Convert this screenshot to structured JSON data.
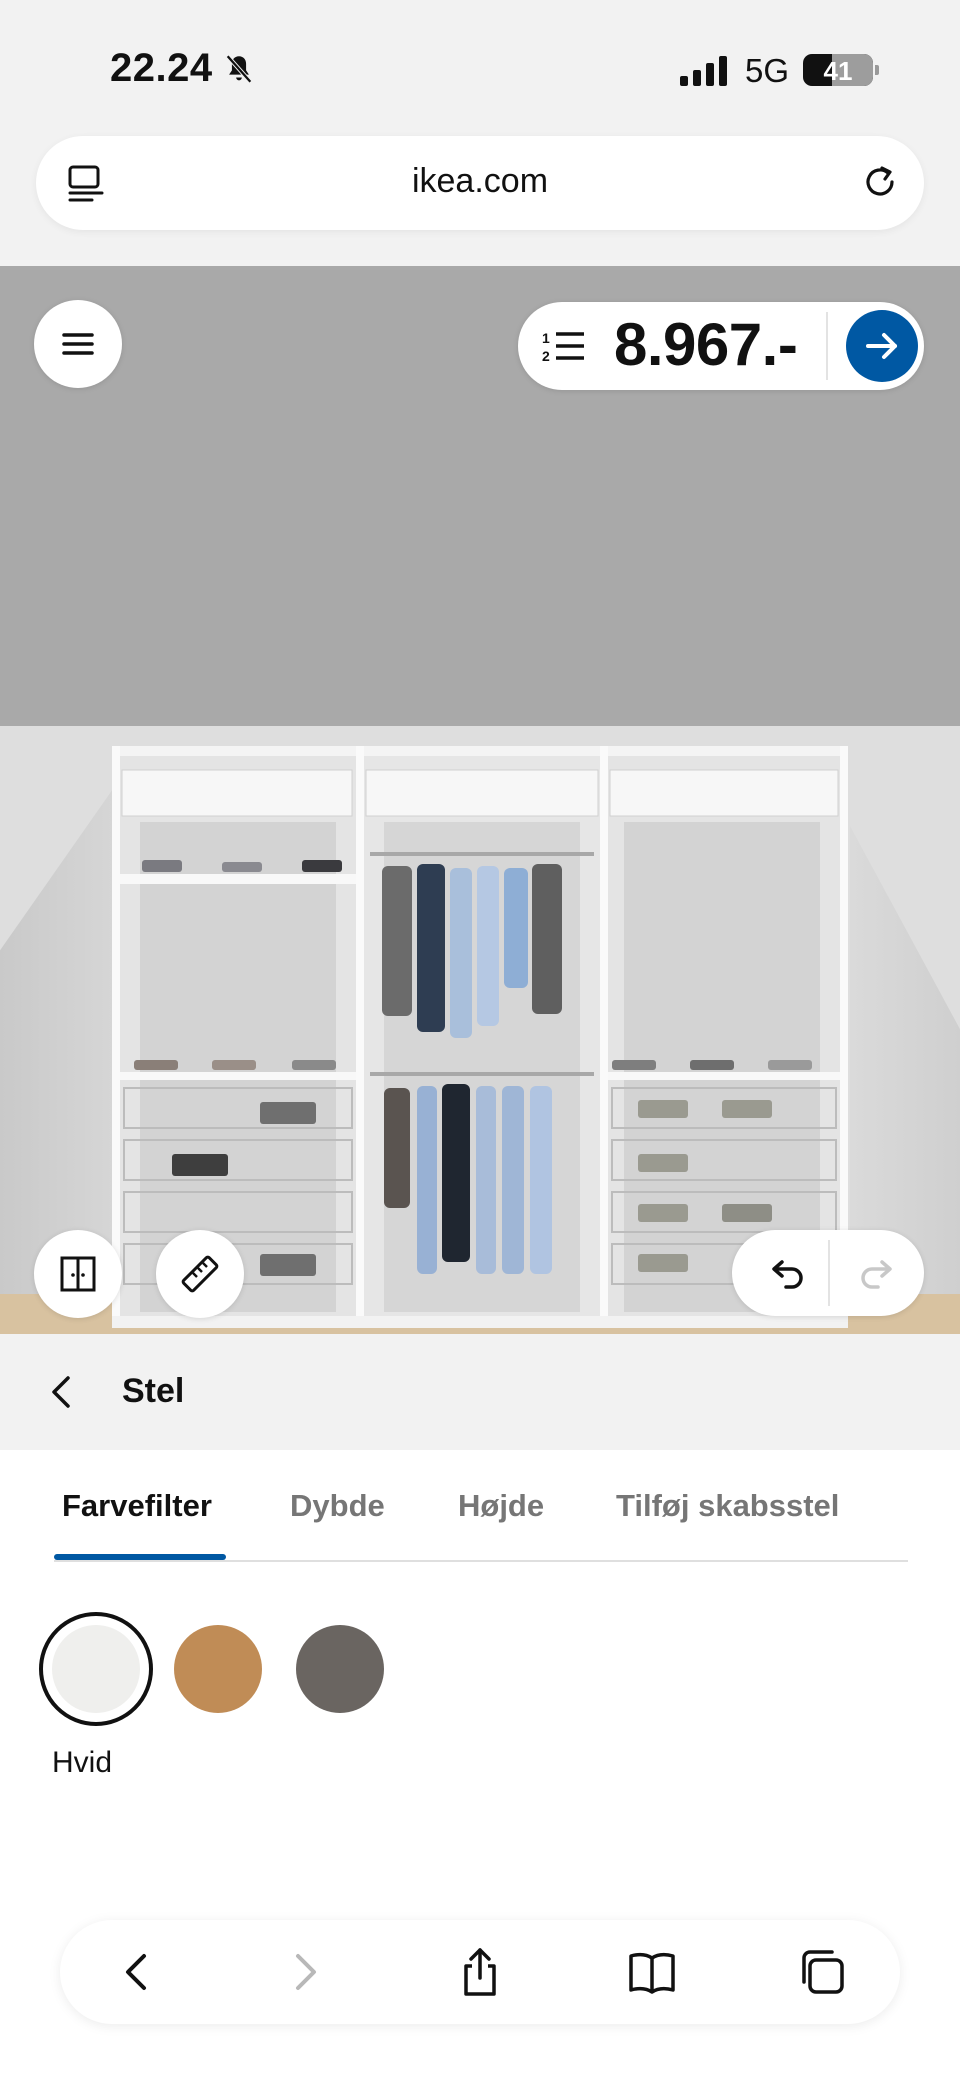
{
  "status_bar": {
    "time": "22.24",
    "network": "5G",
    "battery": "41",
    "battery_level": 0.41
  },
  "address_bar": {
    "domain": "ikea.com"
  },
  "viewer": {
    "price": "8.967.-"
  },
  "panel": {
    "title": "Stel"
  },
  "tabs": [
    {
      "label": "Farvefilter",
      "active": true
    },
    {
      "label": "Dybde",
      "active": false
    },
    {
      "label": "Højde",
      "active": false
    },
    {
      "label": "Tilføj skabsstel",
      "active": false
    }
  ],
  "colors": {
    "selected_label": "Hvid",
    "swatches": [
      {
        "hex": "#efefed",
        "selected": true
      },
      {
        "hex": "#c08c56",
        "selected": false
      },
      {
        "hex": "#6a6561",
        "selected": false
      }
    ],
    "accent": "#0058a3"
  },
  "toolbar_icons": [
    "back-icon",
    "forward-icon",
    "share-icon",
    "bookmarks-icon",
    "tabs-icon"
  ]
}
